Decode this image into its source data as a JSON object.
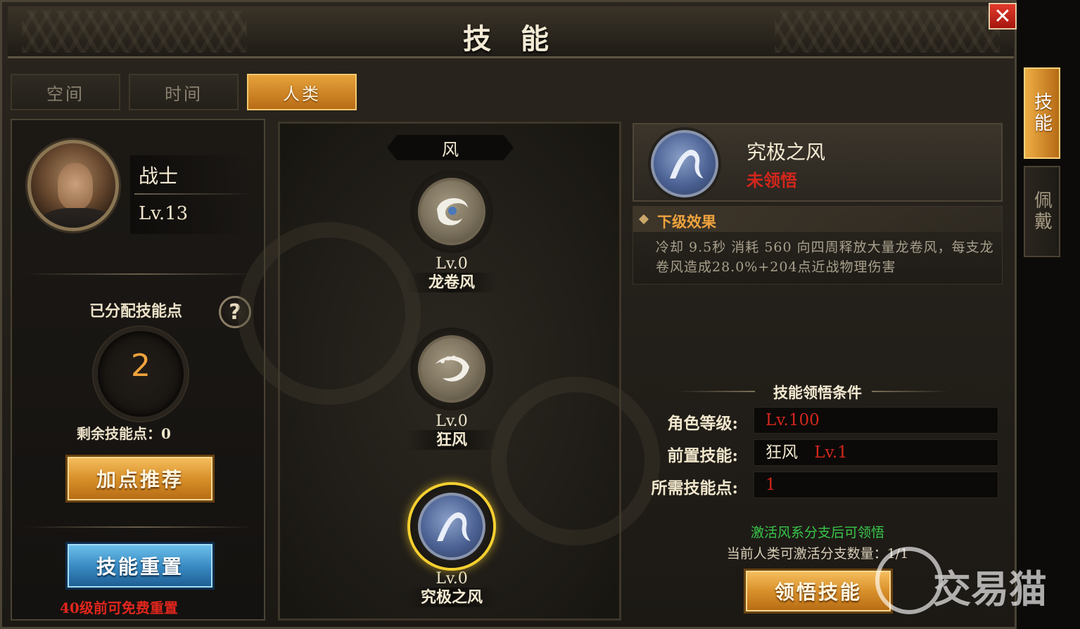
{
  "window": {
    "title": "技 能",
    "close_symbol": "✕"
  },
  "tabs": [
    {
      "label": "空间",
      "active": false
    },
    {
      "label": "时间",
      "active": false
    },
    {
      "label": "人类",
      "active": true
    }
  ],
  "side_tabs": [
    {
      "label": "技能",
      "active": true
    },
    {
      "label": "佩戴",
      "active": false
    }
  ],
  "character": {
    "name": "战士",
    "level": "Lv.13"
  },
  "skill_points": {
    "allocated_label": "已分配技能点",
    "allocated_value": "2",
    "remaining_text": "剩余技能点：0",
    "help_symbol": "?"
  },
  "buttons": {
    "recommend": "加点推荐",
    "reset": "技能重置",
    "reset_note": "40级前可免费重置",
    "learn": "领悟技能"
  },
  "branch": {
    "name": "风",
    "skills": [
      {
        "level": "Lv.0",
        "name": "龙卷风",
        "icon": "tornado-icon",
        "selected": false
      },
      {
        "level": "Lv.0",
        "name": "狂风",
        "icon": "gust-icon",
        "selected": false
      },
      {
        "level": "Lv.0",
        "name": "究极之风",
        "icon": "ultimate-wind-icon",
        "selected": true
      }
    ]
  },
  "detail": {
    "name": "究极之风",
    "status": "未领悟",
    "effect_title": "下级效果",
    "effect_text": "冷却 9.5秒 消耗 560 向四周释放大量龙卷风，每支龙卷风造成28.0%+204点近战物理伤害",
    "conditions_title": "技能领悟条件",
    "conditions": {
      "role_level_label": "角色等级:",
      "role_level_value": "Lv.100",
      "prereq_label": "前置技能:",
      "prereq_skill": "狂风",
      "prereq_level": "Lv.1",
      "points_label": "所需技能点:",
      "points_value": "1"
    },
    "green_note": "激活风系分支后可领悟",
    "grey_note": "当前人类可激活分支数量：1/1"
  },
  "watermark": {
    "text": "交易猫"
  },
  "colors": {
    "gold": "#f0a33e",
    "red": "#d4261c",
    "green": "#38c84a",
    "blue_button": "#3a8cc4"
  }
}
